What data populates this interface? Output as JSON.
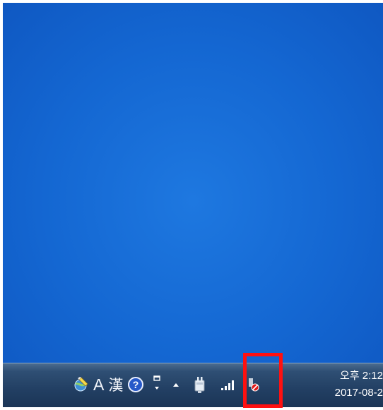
{
  "taskbar": {
    "ime": {
      "globe_icon": "language-bar-globe-icon",
      "mode_label": "A",
      "hanja_label": "漢",
      "help_icon": "help-icon",
      "options_icon": "language-bar-options-icon"
    },
    "tray": {
      "expand_icon": "show-hidden-icons-arrow",
      "power_icon": "power-plug-icon",
      "signal_icon": "signal-bars-icon",
      "network_icon": "network-blocked-icon"
    },
    "clock": {
      "time": "오후 2:12",
      "date": "2017-08-2"
    }
  },
  "highlight_color": "#ff1010"
}
